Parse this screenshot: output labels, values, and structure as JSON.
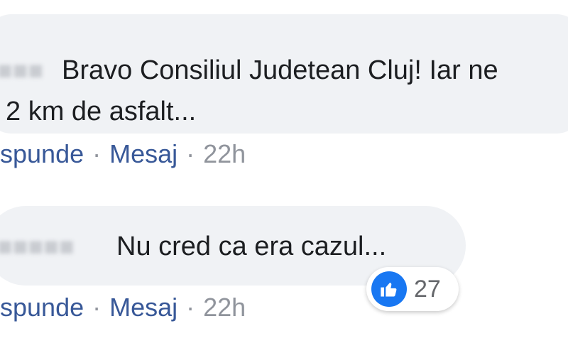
{
  "comments": [
    {
      "text_line1": "Bravo Consiliul Judetean Cluj! Iar ne",
      "text_line2": "2 km de asfalt...",
      "actions": {
        "reply": "spunde",
        "message": "Mesaj",
        "time": "22h"
      }
    },
    {
      "text_line1": "Nu cred ca era cazul...",
      "reaction": {
        "icon": "like-icon",
        "count": "27"
      },
      "actions": {
        "reply": "spunde",
        "message": "Mesaj",
        "time": "22h"
      }
    }
  ],
  "colors": {
    "bubble": "#f0f2f5",
    "link": "#385898",
    "like": "#1877f2",
    "text": "#1c1e21"
  }
}
